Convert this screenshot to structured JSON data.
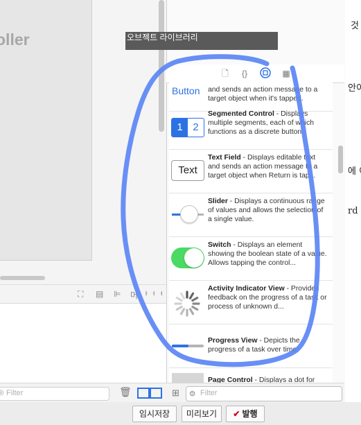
{
  "document": {
    "fragments": [
      "것",
      "안이",
      "에 이",
      "rd 나"
    ]
  },
  "canvas": {
    "scene_title": "oller",
    "filter_placeholder": "Filter",
    "bar_icons": [
      "zoom-fit-icon",
      "embed-icon",
      "align-icon",
      "pin-icon",
      "resolve-icon"
    ],
    "bar_icon_text": "머 ᅡᅥᅥ"
  },
  "tooltip": {
    "text": "오브젝트 라이브러리"
  },
  "library": {
    "tabs": [
      "file-template-icon",
      "code-snippet-icon",
      "object-library-icon",
      "media-library-icon"
    ],
    "active_tab": "object-library-icon",
    "items": [
      {
        "name": "",
        "text": "and sends an action message to a target object when it's tapped.",
        "thumb": "button",
        "thumb_label": "Button"
      },
      {
        "name": "Segmented Control",
        "text": " - Displays multiple segments, each of which functions as a discrete button.",
        "thumb": "segmented",
        "thumb_label": "1 2"
      },
      {
        "name": "Text Field",
        "text": " - Displays editable text and sends an action message to a target object when Return is tap...",
        "thumb": "textfield",
        "thumb_label": "Text"
      },
      {
        "name": "Slider",
        "text": " - Displays a continuous range of values and allows the selection of a single value.",
        "thumb": "slider",
        "thumb_label": ""
      },
      {
        "name": "Switch",
        "text": " - Displays an element showing the boolean state of a value. Allows tapping the control...",
        "thumb": "switch",
        "thumb_label": ""
      },
      {
        "name": "Activity Indicator View",
        "text": " - Provides feedback on the progress of a task or process of unknown d...",
        "thumb": "activity",
        "thumb_label": ""
      },
      {
        "name": "Progress View",
        "text": " - Depicts the progress of a task over time.",
        "thumb": "progress",
        "thumb_label": ""
      },
      {
        "name": "Page Control",
        "text": " - Displays a dot for",
        "thumb": "page",
        "thumb_label": ""
      }
    ],
    "filter_placeholder": "Filter"
  },
  "footer": {
    "save_label": "임시저장",
    "preview_label": "미리보기",
    "publish_label": "발행",
    "publish_check": "✔"
  },
  "colors": {
    "accent": "#2c72e4",
    "annotation": "#5b86f5",
    "switch_on": "#4cd964",
    "publish_check": "#d0021b"
  }
}
